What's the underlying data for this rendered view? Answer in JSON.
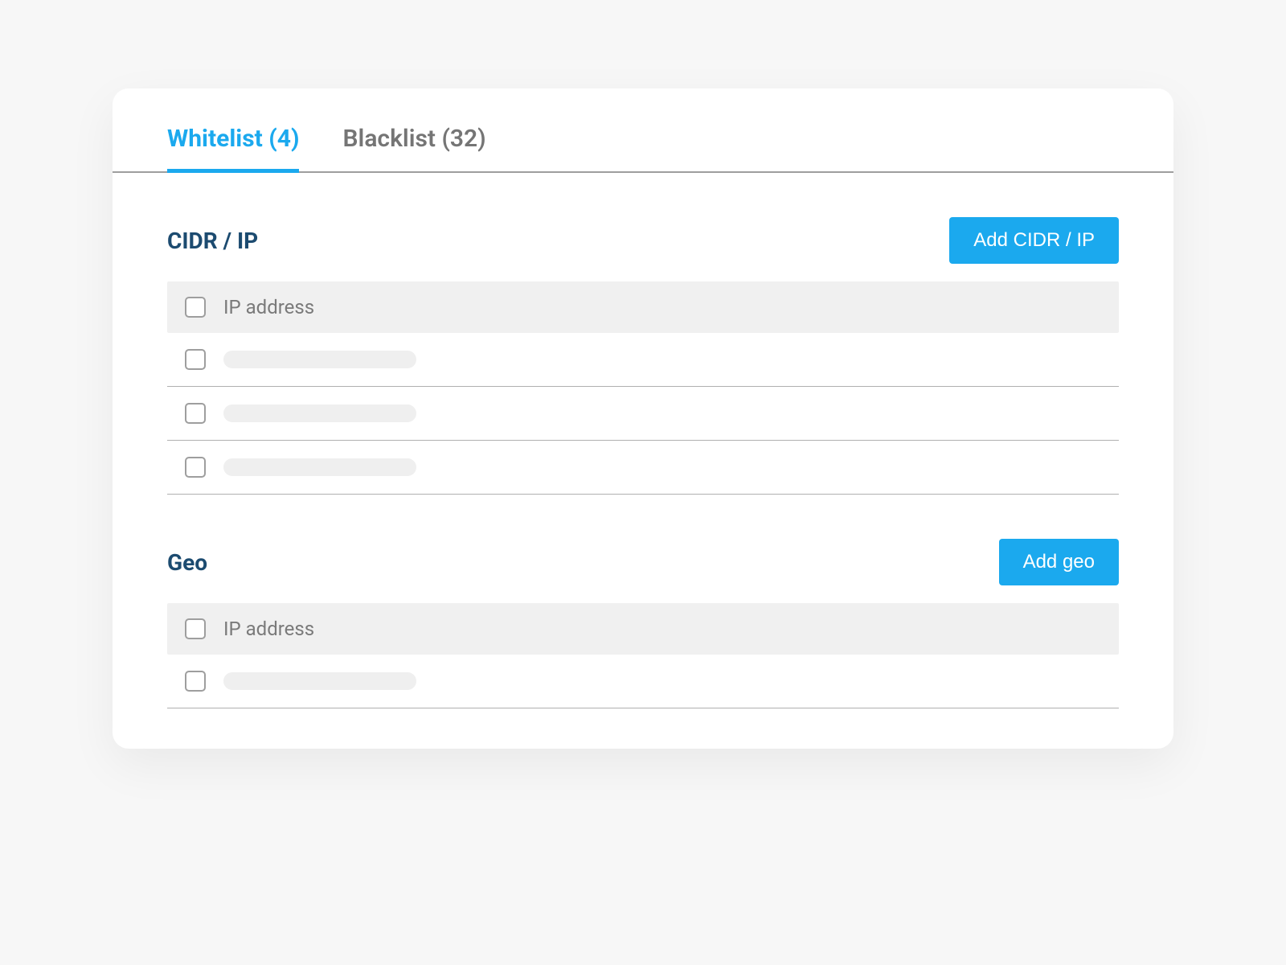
{
  "tabs": {
    "whitelist": {
      "label": "Whitelist (4)",
      "active": true
    },
    "blacklist": {
      "label": "Blacklist (32)",
      "active": false
    }
  },
  "sections": {
    "cidr": {
      "title": "CIDR / IP",
      "add_button_label": "Add CIDR / IP",
      "column_header": "IP address",
      "row_count": 3
    },
    "geo": {
      "title": "Geo",
      "add_button_label": "Add geo",
      "column_header": "IP address",
      "row_count": 1
    }
  },
  "colors": {
    "accent": "#1BA9EE",
    "heading": "#1C4B70"
  }
}
